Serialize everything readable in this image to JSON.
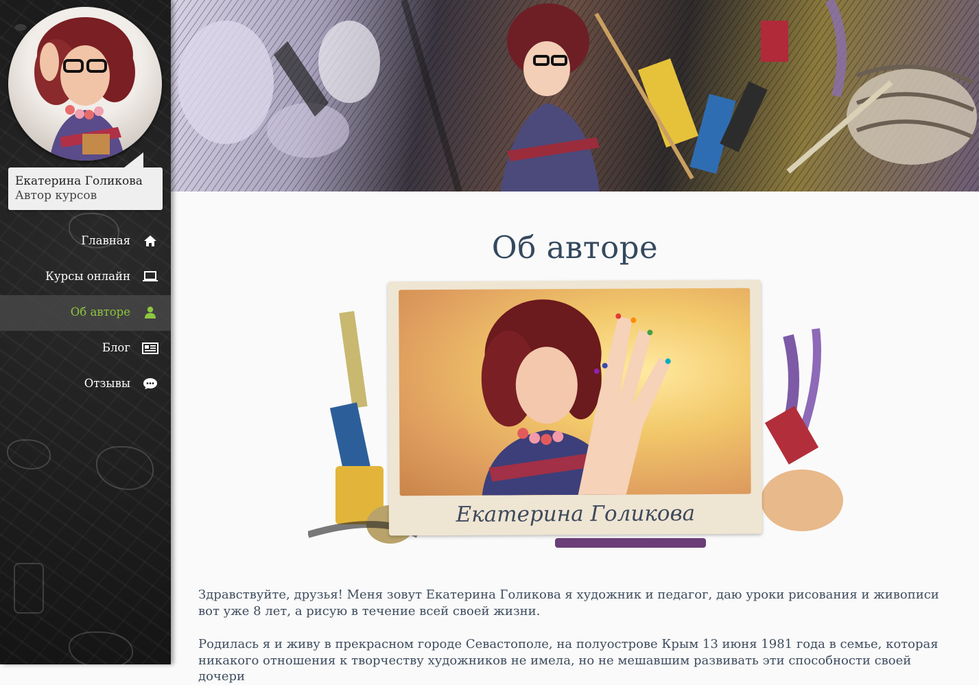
{
  "sidebar": {
    "author_name": "Екатерина Голикова",
    "author_role": "Автор курсов",
    "nav": [
      {
        "label": "Главная",
        "icon": "home-icon",
        "active": false
      },
      {
        "label": "Курсы онлайн",
        "icon": "laptop-icon",
        "active": false
      },
      {
        "label": "Об авторе",
        "icon": "user-icon",
        "active": true
      },
      {
        "label": "Блог",
        "icon": "newspaper-icon",
        "active": false
      },
      {
        "label": "Отзывы",
        "icon": "comment-icon",
        "active": false
      }
    ]
  },
  "colors": {
    "active_nav": "#8dc63f",
    "title": "#34495e",
    "text": "#3f4d5e",
    "sidebar_bg": "#1b1b1b"
  },
  "main": {
    "title": "Об авторе",
    "photo_caption": "Екатерина Голикова",
    "paragraphs": [
      "Здравствуйте, друзья! Меня зовут Екатерина Голикова я художник и педагог, даю уроки рисования и живописи вот уже 8 лет, а рисую в течение всей своей жизни.",
      "Родилась я и живу в прекрасном городе Севастополе, на полуострове Крым 13 июня 1981 года в семье, которая никакого отношения к творчеству художников не имела, но не мешавшим развивать эти способности своей дочери"
    ]
  }
}
